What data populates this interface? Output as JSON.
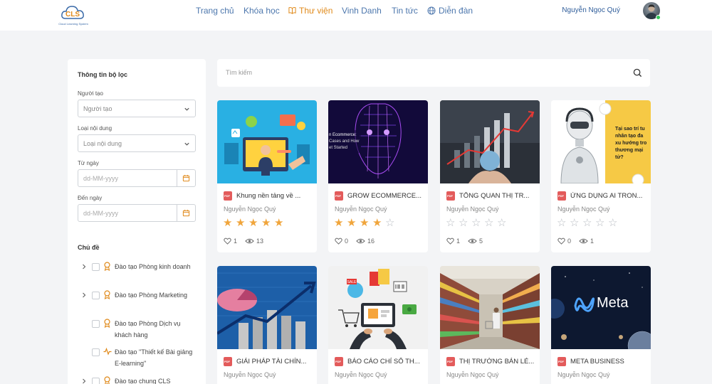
{
  "header": {
    "logo_text": "CLS",
    "logo_tagline": "Cloud Learning System",
    "nav": [
      {
        "label": "Trang chủ",
        "active": false
      },
      {
        "label": "Khóa học",
        "active": false
      },
      {
        "label": "Thư viện",
        "active": true,
        "icon": "book-icon"
      },
      {
        "label": "Vinh Danh",
        "active": false
      },
      {
        "label": "Tin tức",
        "active": false
      },
      {
        "label": "Diễn đàn",
        "active": false,
        "icon": "globe-icon"
      }
    ],
    "user_name": "Nguyễn Ngọc Quý"
  },
  "filter": {
    "title": "Thông tin bộ lọc",
    "creator_label": "Người tạo",
    "creator_value": "Người tạo",
    "content_type_label": "Loại nội dung",
    "content_type_value": "Loại nội dung",
    "from_label": "Từ ngày",
    "from_placeholder": "dd-MM-yyyy",
    "to_label": "Đến ngày",
    "to_placeholder": "dd-MM-yyyy",
    "topics_title": "Chủ đề",
    "topics": [
      {
        "label": "Đào tạo Phòng kinh doanh",
        "expandable": true,
        "icon": "award-icon"
      },
      {
        "label": "Đào tạo Phòng Marketing",
        "expandable": true,
        "icon": "award-icon"
      },
      {
        "label": "Đào tạo Phòng Dịch vụ khách hàng",
        "expandable": false,
        "icon": "award-icon"
      },
      {
        "label": "Đào tạo \"Thiết kế Bài giảng E-learning\"",
        "expandable": false,
        "icon": "activity-icon"
      },
      {
        "label": "Đào tạo chung CLS",
        "expandable": true,
        "icon": "award-icon"
      }
    ]
  },
  "search": {
    "placeholder": "Tìm kiếm"
  },
  "colors": {
    "accent": "#e08a1b",
    "nav": "#4d77ad",
    "star_filled": "#f0a53c",
    "star_empty": "#b8bcc2",
    "pdf": "#e35b5b"
  },
  "cards": [
    {
      "title": "Khung nền tảng về ...",
      "author": "Nguyễn Ngọc Quý",
      "rating": 5,
      "likes": "1",
      "views": "13"
    },
    {
      "title": "GROW ECOMMERCE...",
      "author": "Nguyễn Ngọc Quý",
      "rating": 4,
      "likes": "0",
      "views": "16"
    },
    {
      "title": "TỔNG QUAN THỊ TR...",
      "author": "Nguyễn Ngọc Quý",
      "rating": 0,
      "likes": "1",
      "views": "5"
    },
    {
      "title": "ỨNG DỤNG AI TRON...",
      "author": "Nguyễn Ngọc Quý",
      "rating": 0,
      "likes": "0",
      "views": "1"
    },
    {
      "title": "GIẢI PHÁP TÀI CHÍN...",
      "author": "Nguyễn Ngọc Quý"
    },
    {
      "title": "BÁO CÁO CHỈ SỐ TH...",
      "author": "Nguyễn Ngọc Quý"
    },
    {
      "title": "THỊ TRƯỜNG BÁN LẺ...",
      "author": "Nguyễn Ngọc Quý"
    },
    {
      "title": "META BUSINESS",
      "author": "Nguyễn Ngọc Quý"
    }
  ],
  "thumb_text": {
    "ecommerce_lines": [
      "n Ecommerce:",
      "Cases and How",
      "et Started"
    ],
    "ai_lines": [
      "Tại sao trí tu",
      "nhân tạo đa",
      "xu hướng tro",
      "thương mại",
      "tử?"
    ],
    "sale_tag": "SALE",
    "meta_logo": "Meta"
  }
}
